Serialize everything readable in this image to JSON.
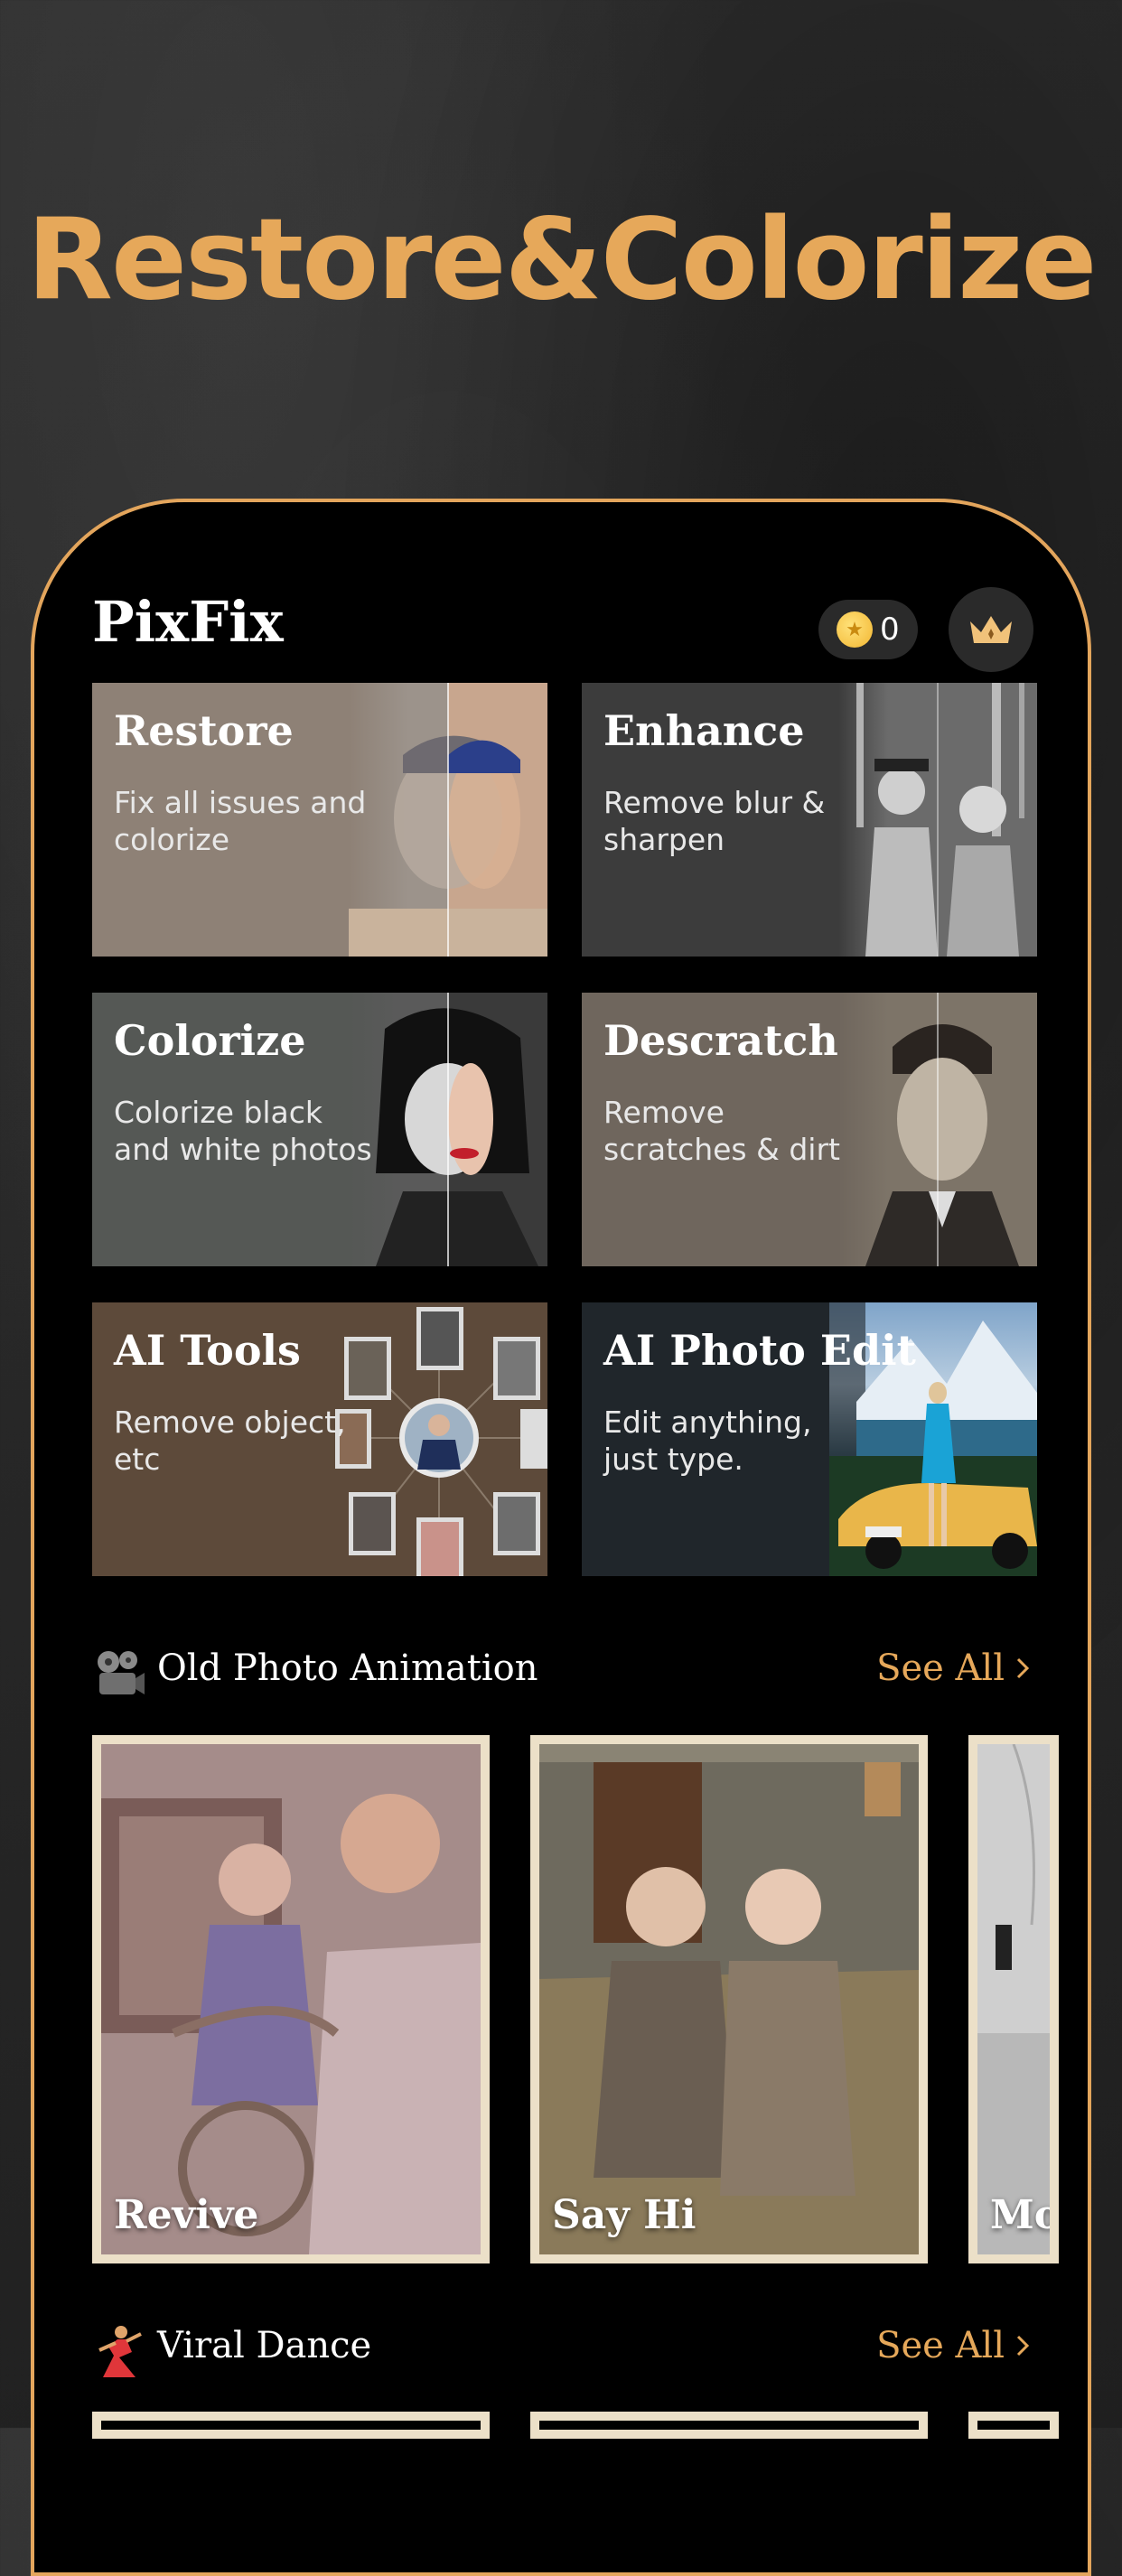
{
  "hero": {
    "title": "Restore&Colorize"
  },
  "header": {
    "brand": "PixFix",
    "coins": "0"
  },
  "tools": [
    {
      "title": "Restore",
      "desc": "Fix all issues and colorize"
    },
    {
      "title": "Enhance",
      "desc": "Remove blur & sharpen"
    },
    {
      "title": "Colorize",
      "desc": "Colorize black and white photos"
    },
    {
      "title": "Descratch",
      "desc": "Remove scratches & dirt"
    },
    {
      "title": "AI Tools",
      "desc": "Remove object, etc"
    },
    {
      "title": "AI Photo Edit",
      "desc": "Edit anything, just type."
    }
  ],
  "sections": {
    "animation": {
      "title": "Old Photo Animation",
      "see_all": "See All",
      "items": [
        {
          "label": "Revive"
        },
        {
          "label": "Say Hi"
        },
        {
          "label": "Mo"
        }
      ]
    },
    "dance": {
      "title": "Viral Dance",
      "see_all": "See All"
    }
  },
  "colors": {
    "accent": "#e6a85a",
    "background": "#000000"
  },
  "icons": [
    "coin-icon",
    "crown-icon",
    "film-projector-icon",
    "dancer-icon",
    "chevron-right-icon"
  ]
}
